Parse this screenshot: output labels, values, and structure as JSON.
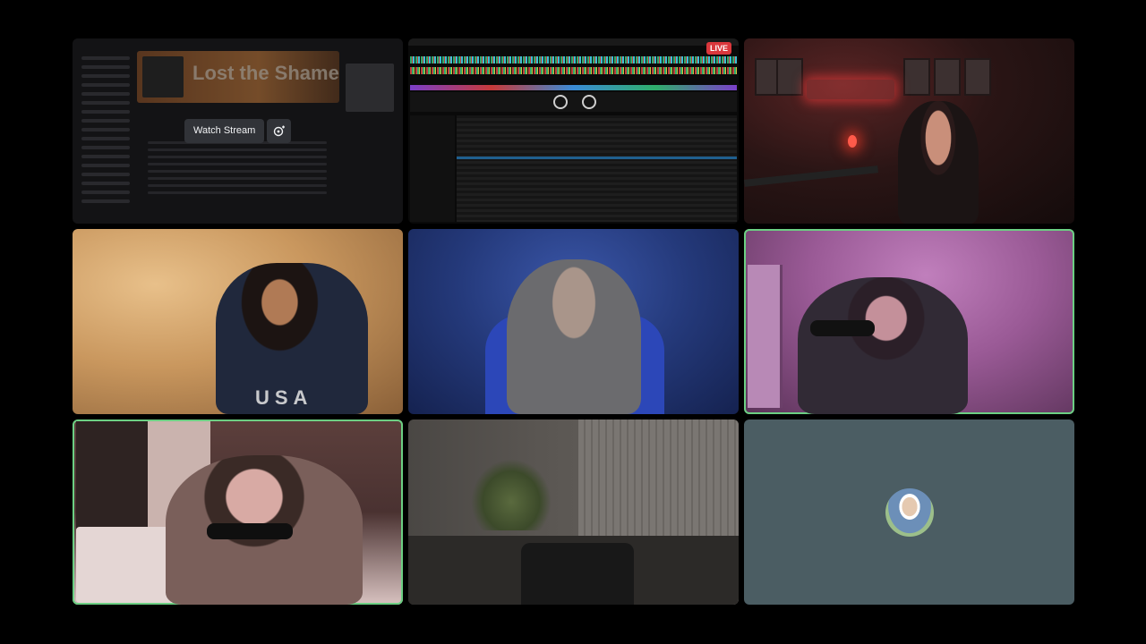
{
  "call": {
    "tiles": [
      {
        "id": "tile-stream-preview",
        "speaking": false
      },
      {
        "id": "tile-dj-screenshare",
        "speaking": false
      },
      {
        "id": "tile-red-room",
        "speaking": false
      },
      {
        "id": "tile-warm-room",
        "speaking": false
      },
      {
        "id": "tile-blue-room",
        "speaking": false
      },
      {
        "id": "tile-pink-room",
        "speaking": true
      },
      {
        "id": "tile-bedroom",
        "speaking": true
      },
      {
        "id": "tile-grey-room",
        "speaking": false
      },
      {
        "id": "tile-avatar",
        "speaking": false
      }
    ]
  },
  "stream_preview": {
    "album_title": "Lost the Shame",
    "watch_label": "Watch Stream",
    "popout_icon": "popout-icon"
  },
  "screenshare": {
    "live_label": "LIVE"
  },
  "webcam_text": {
    "shirt": "USA"
  },
  "colors": {
    "speaking_ring": "#6ccf83",
    "live_badge": "#da373c",
    "avatar_tile_bg": "#4b5d63",
    "button_bg": "#313338"
  }
}
